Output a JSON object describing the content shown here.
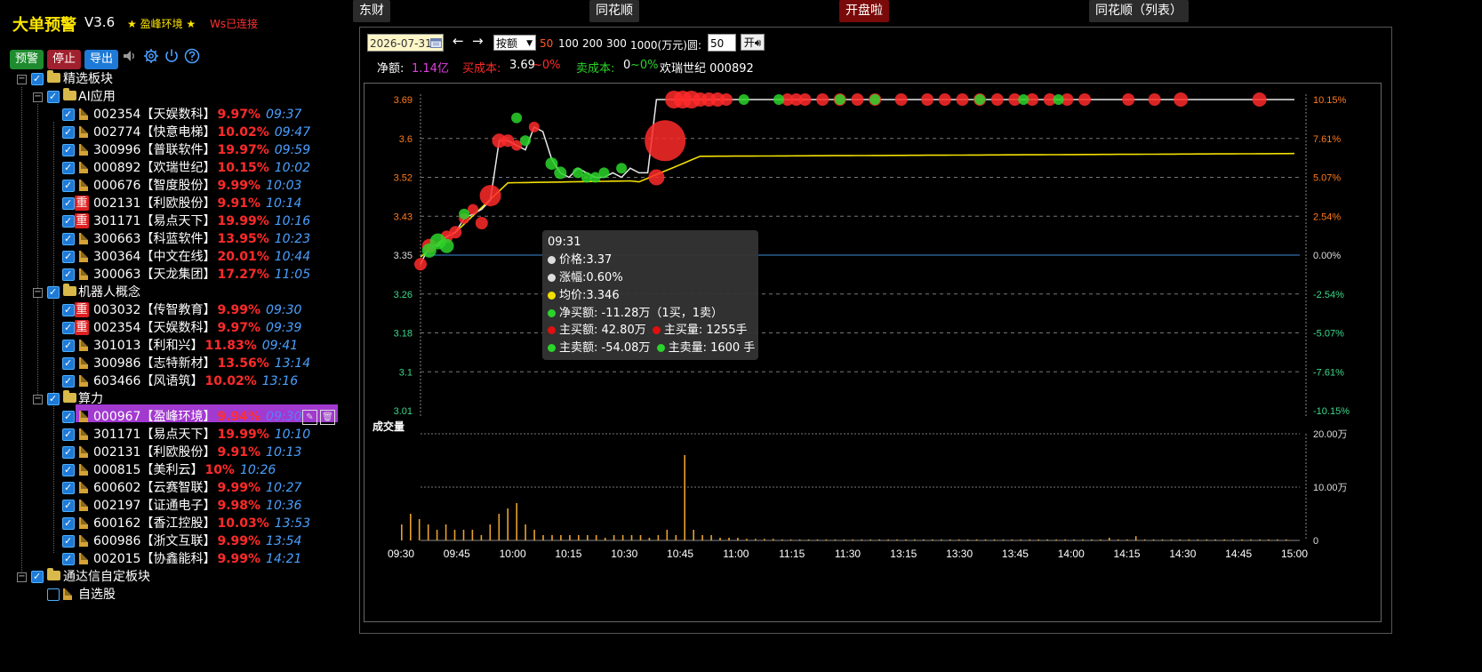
{
  "app": {
    "title": "大单预警",
    "version": "V3.6",
    "star_text": "★ 盈峰环境 ★",
    "ws_status": "Ws已连接"
  },
  "toolbar": {
    "warn": "预警",
    "stop": "停止",
    "export": "导出",
    "icons": [
      "speaker-icon",
      "gear-icon",
      "power-icon",
      "help-icon"
    ]
  },
  "tree": {
    "root_label": "精选板块",
    "groups": [
      {
        "label": "AI应用",
        "items": [
          {
            "code": "002354",
            "name": "【天娱数科】",
            "pct": "9.97%",
            "time": "09:37",
            "badge": ""
          },
          {
            "code": "002774",
            "name": "【快意电梯】",
            "pct": "10.02%",
            "time": "09:47",
            "badge": ""
          },
          {
            "code": "300996",
            "name": "【普联软件】",
            "pct": "19.97%",
            "time": "09:59",
            "badge": ""
          },
          {
            "code": "000892",
            "name": "【欢瑞世纪】",
            "pct": "10.15%",
            "time": "10:02",
            "badge": ""
          },
          {
            "code": "000676",
            "name": "【智度股份】",
            "pct": "9.99%",
            "time": "10:03",
            "badge": ""
          },
          {
            "code": "002131",
            "name": "【利欧股份】",
            "pct": "9.91%",
            "time": "10:14",
            "badge": "重"
          },
          {
            "code": "301171",
            "name": "【易点天下】",
            "pct": "19.99%",
            "time": "10:16",
            "badge": "重"
          },
          {
            "code": "300663",
            "name": "【科蓝软件】",
            "pct": "13.95%",
            "time": "10:23",
            "badge": ""
          },
          {
            "code": "300364",
            "name": "【中文在线】",
            "pct": "20.01%",
            "time": "10:44",
            "badge": ""
          },
          {
            "code": "300063",
            "name": "【天龙集团】",
            "pct": "17.27%",
            "time": "11:05",
            "badge": ""
          }
        ]
      },
      {
        "label": "机器人概念",
        "items": [
          {
            "code": "003032",
            "name": "【传智教育】",
            "pct": "9.99%",
            "time": "09:30",
            "badge": "重"
          },
          {
            "code": "002354",
            "name": "【天娱数科】",
            "pct": "9.97%",
            "time": "09:39",
            "badge": "重"
          },
          {
            "code": "301013",
            "name": "【利和兴】",
            "pct": "11.83%",
            "time": "09:41",
            "badge": ""
          },
          {
            "code": "300986",
            "name": "【志特新材】",
            "pct": "13.56%",
            "time": "13:14",
            "badge": ""
          },
          {
            "code": "603466",
            "name": "【风语筑】",
            "pct": "10.02%",
            "time": "13:16",
            "badge": ""
          }
        ]
      },
      {
        "label": "算力",
        "items": [
          {
            "code": "000967",
            "name": "【盈峰环境】",
            "pct": "9.94%",
            "time": "09:30",
            "badge": "",
            "selected": true
          },
          {
            "code": "301171",
            "name": "【易点天下】",
            "pct": "19.99%",
            "time": "10:10",
            "badge": ""
          },
          {
            "code": "002131",
            "name": "【利欧股份】",
            "pct": "9.91%",
            "time": "10:13",
            "badge": ""
          },
          {
            "code": "000815",
            "name": "【美利云】",
            "pct": "10%",
            "time": "10:26",
            "badge": ""
          },
          {
            "code": "600602",
            "name": "【云赛智联】",
            "pct": "9.99%",
            "time": "10:27",
            "badge": ""
          },
          {
            "code": "002197",
            "name": "【证通电子】",
            "pct": "9.98%",
            "time": "10:36",
            "badge": ""
          },
          {
            "code": "600162",
            "name": "【香江控股】",
            "pct": "10.03%",
            "time": "13:53",
            "badge": ""
          },
          {
            "code": "600986",
            "name": "【浙文互联】",
            "pct": "9.99%",
            "time": "13:54",
            "badge": ""
          },
          {
            "code": "002015",
            "name": "【协鑫能科】",
            "pct": "9.99%",
            "time": "14:21",
            "badge": ""
          }
        ]
      }
    ],
    "tdx_label": "通达信自定板块",
    "tdx_child": "自选股"
  },
  "tabs": [
    "东财",
    "同花顺",
    "开盘啦",
    "同花顺（列表）"
  ],
  "controls": {
    "date": "2026-07-31",
    "prev": "←",
    "next": "→",
    "mode": "按额",
    "sizes": [
      "50",
      "100",
      "200",
      "300",
      "1000(万元)"
    ],
    "circle_label": "圆:",
    "circle_value": "50",
    "open": "开"
  },
  "stats": {
    "net_label": "净额:",
    "net_value": "1.14亿",
    "buy_cost_label": "买成本:",
    "buy_cost_value": "3.69",
    "buy_cost_pct": "~0%",
    "sell_cost_label": "卖成本:",
    "sell_cost_value": "0",
    "sell_cost_pct": "~0%",
    "stock": "欢瑞世纪 000892"
  },
  "colors": {
    "up": "#ff2a2a",
    "down": "#2ad42a",
    "avg": "#f2e000",
    "time_blue": "#4aa0ff",
    "selected": "#a23ad0"
  },
  "tooltip": {
    "time": "09:31",
    "price": "价格:3.37",
    "change": "涨幅:0.60%",
    "avg": "均价:3.346",
    "net_buy": "净买额: -11.28万（1买，1卖）",
    "main_buy_amt": "主买额: 42.80万",
    "main_buy_vol": "主买量: 1255手",
    "main_sell_amt": "主卖额: -54.08万",
    "main_sell_vol": "主卖量: 1600 手"
  },
  "chart_data": {
    "type": "line",
    "y_ticks": [
      "3.69",
      "3.6",
      "3.52",
      "3.43",
      "3.35",
      "3.26",
      "3.18",
      "3.1",
      "3.01"
    ],
    "pct_ticks": [
      "10.15%",
      "7.61%",
      "5.07%",
      "2.54%",
      "0.00%",
      "-2.54%",
      "-5.07%",
      "-7.61%",
      "-10.15%"
    ],
    "ylim": [
      3.01,
      3.69
    ],
    "x_ticks": [
      "09:30",
      "09:45",
      "10:00",
      "10:15",
      "10:30",
      "10:45",
      "11:00",
      "11:15",
      "11:30",
      "13:15",
      "13:30",
      "13:45",
      "14:00",
      "14:15",
      "14:30",
      "14:45",
      "15:00"
    ],
    "volume_label": "成交量",
    "volume_ticks": [
      "20.00万",
      "10.00万",
      "0"
    ],
    "price_series": {
      "name": "价格",
      "x": [
        0,
        1,
        2,
        3,
        4,
        5,
        6,
        7,
        8,
        9,
        10,
        11,
        12,
        13,
        14,
        15,
        16,
        17,
        18,
        19,
        20,
        21,
        22,
        23,
        24,
        25,
        26,
        27,
        28,
        29,
        30,
        31,
        32,
        33,
        34,
        35,
        36,
        37,
        38,
        39,
        40,
        41,
        42,
        43,
        44,
        45,
        46,
        47,
        48,
        49,
        50,
        51,
        52,
        53,
        54,
        55,
        56,
        57,
        58,
        59,
        60,
        61,
        62,
        63,
        64,
        65,
        66,
        67,
        68,
        69,
        70,
        71,
        72,
        73,
        74,
        75,
        76,
        77,
        78,
        79,
        80,
        81,
        82,
        83,
        84,
        85,
        86,
        87,
        88,
        89,
        90,
        91,
        92,
        93,
        94,
        95,
        96,
        97,
        98,
        99,
        100
      ],
      "y": [
        3.33,
        3.37,
        3.37,
        3.39,
        3.4,
        3.43,
        3.44,
        3.45,
        3.47,
        3.6,
        3.6,
        3.59,
        3.58,
        3.63,
        3.62,
        3.56,
        3.53,
        3.52,
        3.54,
        3.53,
        3.52,
        3.52,
        3.53,
        3.52,
        3.54,
        3.53,
        3.53,
        3.69,
        3.69,
        3.69,
        3.69,
        3.69,
        3.69,
        3.69,
        3.69,
        3.69,
        3.69,
        3.69,
        3.69,
        3.69,
        3.69,
        3.69,
        3.69,
        3.69,
        3.69,
        3.69,
        3.69,
        3.69,
        3.69,
        3.69,
        3.69,
        3.69,
        3.69,
        3.69,
        3.69,
        3.69,
        3.69,
        3.69,
        3.69,
        3.69,
        3.69,
        3.69,
        3.69,
        3.69,
        3.69,
        3.69,
        3.69,
        3.69,
        3.69,
        3.69,
        3.69,
        3.69,
        3.69,
        3.69,
        3.69,
        3.69,
        3.69,
        3.69,
        3.69,
        3.69,
        3.69,
        3.69,
        3.69,
        3.69,
        3.69,
        3.69,
        3.69,
        3.69,
        3.69,
        3.69,
        3.69,
        3.69,
        3.69,
        3.69,
        3.69,
        3.69,
        3.69,
        3.69,
        3.69,
        3.69,
        3.69
      ]
    },
    "avg_series": {
      "name": "均价",
      "y_start": 3.346,
      "y_end": 3.572
    },
    "volume": [
      3,
      5,
      4,
      3,
      2,
      3,
      2,
      2,
      2,
      1,
      3,
      5,
      6,
      7,
      3,
      2,
      1,
      1,
      1,
      1,
      1,
      1,
      1,
      0.5,
      1,
      1,
      1,
      1,
      0.5,
      1,
      2,
      1,
      16,
      2,
      1,
      1,
      0.5,
      0.5,
      0.5,
      0.3,
      0.3,
      0.3,
      0.3,
      0.2,
      0.2,
      0.2,
      0.2,
      0.2,
      0.2,
      0.2,
      0.2,
      0.2,
      0.2,
      0.2,
      0.2,
      0.2,
      0.2,
      0.2,
      0.2,
      0.2,
      0.2,
      0.2,
      0.2,
      0.2,
      0.2,
      0.2,
      0.2,
      0.2,
      0.2,
      0.2,
      0.2,
      0.2,
      0.2,
      0.2,
      0.2,
      0.2,
      0.2,
      0.2,
      0.2,
      0.2,
      0.5,
      0.2,
      0.2,
      0.8,
      0.2,
      0.2,
      0.2,
      0.2,
      0.2,
      0.2,
      0.2,
      0.2,
      0.2,
      0.2,
      0.2,
      0.2,
      0.2,
      0.2,
      0.2,
      0.2,
      0.2
    ],
    "bubbles_sell_time": [
      1,
      2,
      3,
      4,
      5,
      6,
      12,
      14,
      17,
      18,
      19,
      20,
      21,
      22,
      24,
      25,
      36,
      37,
      38,
      39,
      40,
      41,
      53,
      54,
      79,
      80,
      91,
      92
    ]
  }
}
